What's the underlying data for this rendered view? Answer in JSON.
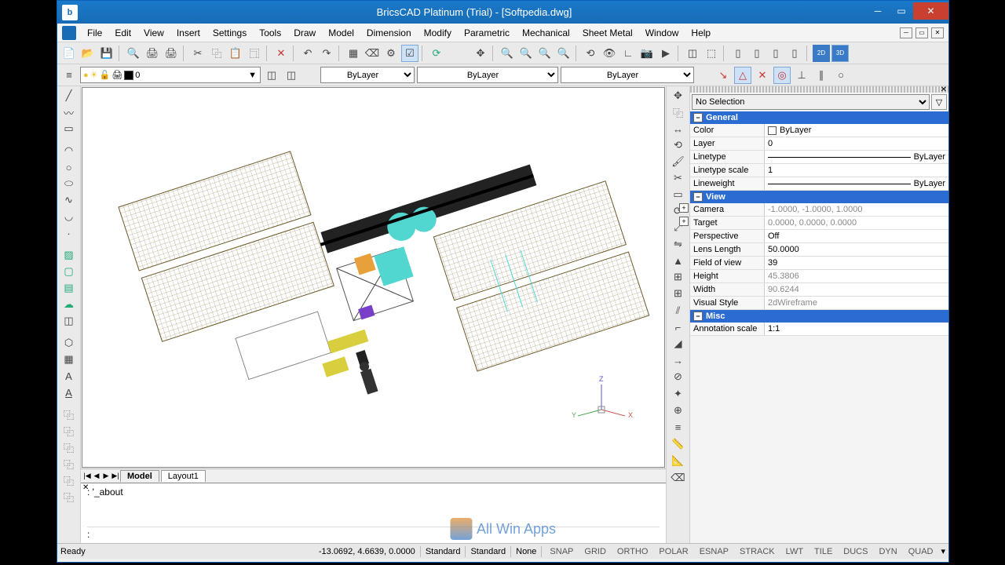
{
  "titlebar": {
    "title": "BricsCAD Platinum (Trial) - [Softpedia.dwg]"
  },
  "menu": {
    "items": [
      "File",
      "Edit",
      "View",
      "Insert",
      "Settings",
      "Tools",
      "Draw",
      "Model",
      "Dimension",
      "Modify",
      "Parametric",
      "Mechanical",
      "Sheet Metal",
      "Window",
      "Help"
    ]
  },
  "layerbar": {
    "layer_value": "0",
    "color_value": "ByLayer",
    "linetype_value": "ByLayer",
    "lineweight_value": "ByLayer"
  },
  "tabs": {
    "nav": [
      "|◀",
      "◀",
      "▶",
      "▶|"
    ],
    "model": "Model",
    "layout1": "Layout1"
  },
  "command": {
    "history": ": '_about",
    "prompt": ":"
  },
  "properties": {
    "selection": "No Selection",
    "groups": {
      "general": {
        "title": "General",
        "rows": {
          "color_k": "Color",
          "color_v": "ByLayer",
          "layer_k": "Layer",
          "layer_v": "0",
          "linetype_k": "Linetype",
          "linetype_v": "ByLayer",
          "ltscale_k": "Linetype scale",
          "ltscale_v": "1",
          "lweight_k": "Lineweight",
          "lweight_v": "ByLayer"
        }
      },
      "view": {
        "title": "View",
        "rows": {
          "camera_k": "Camera",
          "camera_v": "-1.0000, -1.0000, 1.0000",
          "target_k": "Target",
          "target_v": "0.0000, 0.0000, 0.0000",
          "persp_k": "Perspective",
          "persp_v": "Off",
          "lens_k": "Lens Length",
          "lens_v": "50.0000",
          "fov_k": "Field of view",
          "fov_v": "39",
          "height_k": "Height",
          "height_v": "45.3806",
          "width_k": "Width",
          "width_v": "90.6244",
          "vstyle_k": "Visual Style",
          "vstyle_v": "2dWireframe"
        }
      },
      "misc": {
        "title": "Misc",
        "rows": {
          "annoscale_k": "Annotation scale",
          "annoscale_v": "1:1"
        }
      }
    }
  },
  "status": {
    "ready": "Ready",
    "coords": "-13.0692, 4.6639, 0.0000",
    "std1": "Standard",
    "std2": "Standard",
    "none": "None",
    "toggles": [
      "SNAP",
      "GRID",
      "ORTHO",
      "POLAR",
      "ESNAP",
      "STRACK",
      "LWT",
      "TILE",
      "DUCS",
      "DYN",
      "QUAD"
    ]
  },
  "ucs": {
    "x": "X",
    "y": "Y",
    "z": "Z"
  },
  "watermark": "All Win Apps"
}
